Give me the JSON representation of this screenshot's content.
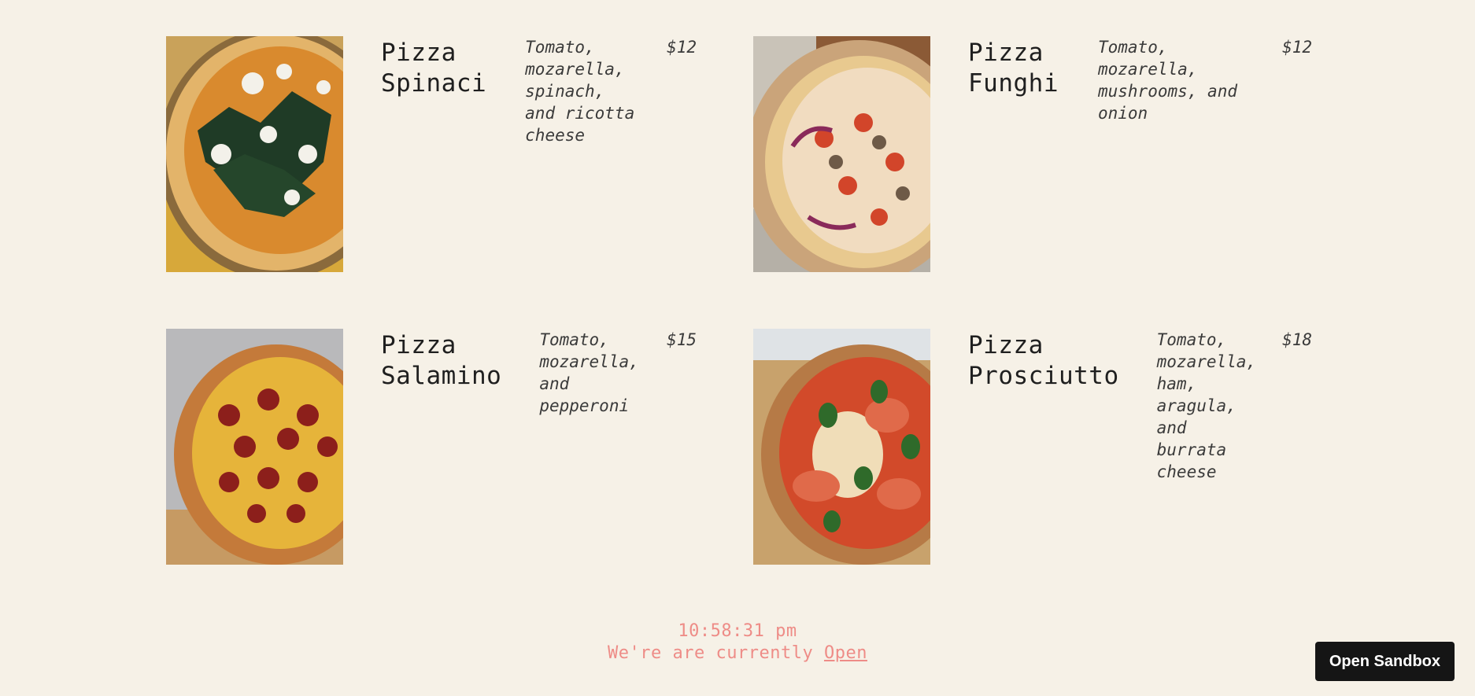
{
  "menu": {
    "items": [
      {
        "name_line1": "Pizza",
        "name_line2": "Spinaci",
        "description": "Tomato, mozarella, spinach, and ricotta cheese",
        "price": "$12",
        "image_icon": "pizza-spinaci-photo"
      },
      {
        "name_line1": "Pizza",
        "name_line2": "Funghi",
        "description": "Tomato, mozarella, mushrooms, and onion",
        "price": "$12",
        "image_icon": "pizza-funghi-photo"
      },
      {
        "name_line1": "Pizza",
        "name_line2": "Salamino",
        "description": "Tomato, mozarella, and pepperoni",
        "price": "$15",
        "image_icon": "pizza-salamino-photo"
      },
      {
        "name_line1": "Pizza",
        "name_line2": "Prosciutto",
        "description": "Tomato, mozarella, ham, aragula, and burrata cheese",
        "price": "$18",
        "image_icon": "pizza-prosciutto-photo"
      }
    ]
  },
  "footer": {
    "time": "10:58:31 pm",
    "status_prefix": "We're are currently",
    "status_link": "Open"
  },
  "sandbox_button": {
    "label": "Open Sandbox"
  },
  "colors": {
    "background": "#f6f1e7",
    "footer_text": "#ee8c87",
    "button_bg": "#151515"
  }
}
